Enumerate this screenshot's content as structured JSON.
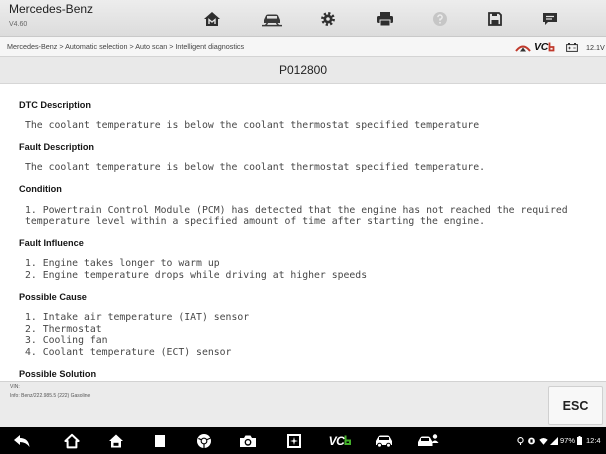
{
  "header": {
    "app_title": "Mercedes-Benz",
    "version": "V4.60",
    "toolbar": [
      {
        "icon": "home-icon"
      },
      {
        "icon": "vehicle-lift-icon"
      },
      {
        "icon": "gear-icon"
      },
      {
        "icon": "printer-icon"
      },
      {
        "icon": "help-icon",
        "disabled": true
      },
      {
        "icon": "save-icon"
      },
      {
        "icon": "chat-icon"
      }
    ]
  },
  "breadcrumb": {
    "path": "Mercedes-Benz > Automatic selection > Auto scan > Intelligent diagnostics",
    "connection_icon": "wireless-link-icon",
    "vci_logo": "VC",
    "battery_icon": "battery-icon",
    "voltage": "12.1V"
  },
  "dtc": {
    "code": "P012800",
    "sections": [
      {
        "heading": "DTC Description",
        "lines": [
          "The coolant temperature is below the coolant thermostat specified temperature"
        ]
      },
      {
        "heading": "Fault Description",
        "lines": [
          "The coolant temperature is below the coolant thermostat specified temperature."
        ]
      },
      {
        "heading": "Condition",
        "lines": [
          "1. Powertrain Control Module (PCM) has detected that the engine has not reached the required temperature level within a specified amount of time after starting the engine."
        ]
      },
      {
        "heading": "Fault Influence",
        "lines": [
          "1. Engine takes longer to warm up",
          "2. Engine temperature drops while driving at higher speeds"
        ]
      },
      {
        "heading": "Possible Cause",
        "lines": [
          "1. Intake air temperature (IAT) sensor",
          "2. Thermostat",
          "3. Cooling fan",
          "4. Coolant temperature (ECT) sensor"
        ]
      },
      {
        "heading": "Possible Solution",
        "lines": []
      }
    ]
  },
  "footer": {
    "vin_label": "VIN:",
    "info": "Info: Benz/222.985.5 (222) Gasoline",
    "esc_label": "ESC"
  },
  "navbar": {
    "items": [
      {
        "icon": "back-icon"
      },
      {
        "icon": "home-outline-icon"
      },
      {
        "icon": "home-filled-icon"
      },
      {
        "icon": "recent-apps-icon"
      },
      {
        "icon": "browser-icon"
      },
      {
        "icon": "camera-icon"
      },
      {
        "icon": "gallery-icon"
      },
      {
        "icon": "vci-icon"
      },
      {
        "icon": "car-icon"
      },
      {
        "icon": "car-user-icon"
      }
    ],
    "vci_logo": "VC",
    "status": {
      "icons": [
        "location-icon",
        "sim-icon",
        "wifi-icon",
        "signal-icon",
        "battery-icon"
      ],
      "battery_percent": "97%",
      "time": "12:4"
    }
  },
  "colors": {
    "header_bg": "#e4e4e4",
    "title_band_bg": "#e9e9e9",
    "content_bg": "#ffffff",
    "footer_bg": "#ebebeb",
    "navbar_bg": "#000000",
    "connection_red": "#c0392b",
    "vci_green": "#43b02a"
  }
}
